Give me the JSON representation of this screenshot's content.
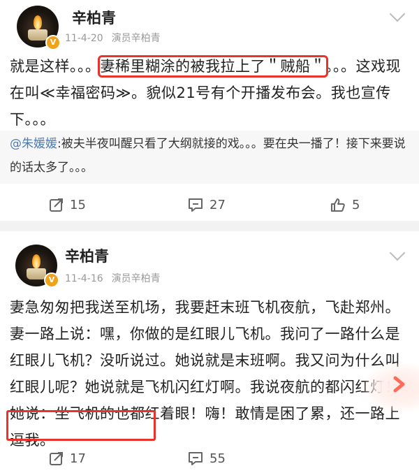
{
  "posts": [
    {
      "username": "辛柏青",
      "date": "11-4-20",
      "source": "演员辛柏青",
      "text_before": "就是这样。。。",
      "text_highlight": "妻稀里糊涂的被我拉上了＂贼船＂",
      "text_after": "。。。这戏现在叫≪幸福密码≫。貌似21号有个开播发布会。我也宣传下。。。",
      "repost": {
        "mention": "@朱媛媛",
        "text": ":被夫半夜叫醒只看了大纲就接的戏。。。要在央一播了！接下来要说的话太多了。。。"
      },
      "actions": {
        "repost": "15",
        "comment": "27",
        "like": "5"
      }
    },
    {
      "username": "辛柏青",
      "date": "11-4-16",
      "source": "演员辛柏青",
      "text": "妻急匆匆把我送至机场，我要赶末班飞机夜航，飞赴郑州。妻一路上说：嘿，你做的是红眼儿飞机。我问了一路什么是红眼儿飞机？没听说过。她说就是末班啊。我又问为什么叫红眼儿呢？她说就是飞机闪红灯啊。我说夜航的都闪红灯！她说：坐飞机的也都红着眼！嗨！敢情是困了累，还一路上逗我。",
      "actions": {
        "repost": "17",
        "comment": "55"
      }
    }
  ],
  "icons": {
    "verified": "verified-v-badge",
    "menu": "chevron-down-icon",
    "repost": "repost-icon",
    "comment": "comment-icon",
    "like": "thumbs-up-icon"
  },
  "colors": {
    "highlight_box": "#e8332a",
    "mention": "#4c7ab5",
    "verified": "#f0a31a"
  }
}
